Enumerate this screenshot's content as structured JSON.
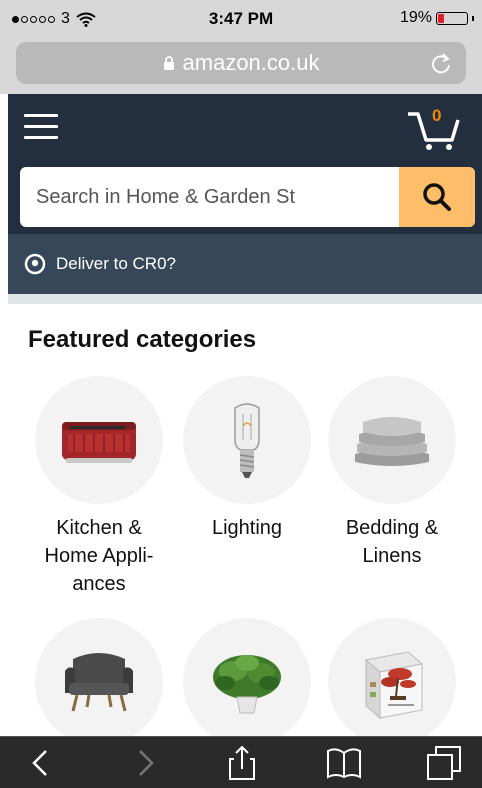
{
  "status_bar": {
    "carrier": "3",
    "time": "3:47 PM",
    "battery": "19%",
    "battery_level": 0.19,
    "signal_icon": "signal-dots-icon",
    "wifi_icon": "wifi-icon"
  },
  "browser": {
    "url": "amazon.co.uk",
    "lock_icon": "lock-icon",
    "reload_icon": "reload-icon"
  },
  "header": {
    "menu_icon": "hamburger-menu-icon",
    "cart_icon": "cart-icon",
    "cart_count": "0"
  },
  "search": {
    "placeholder": "Search in Home & Garden St",
    "search_icon": "search-icon"
  },
  "delivery": {
    "label": "Deliver to CR0?",
    "icon": "location-pin-icon"
  },
  "featured": {
    "title": "Featured categories",
    "categories": [
      {
        "label": "Kitchen & Home Appli-ances",
        "line1": "Kitchen &",
        "line2": "Home Appli-",
        "line3": "ances",
        "image": "toaster-image"
      },
      {
        "label": "Lighting",
        "line1": "Lighting",
        "image": "light-bulb-image"
      },
      {
        "label": "Bedding & Linens",
        "line1": "Bedding &",
        "line2": "Linens",
        "image": "pillows-image"
      },
      {
        "label": "",
        "image": "armchair-image"
      },
      {
        "label": "",
        "image": "plant-image"
      },
      {
        "label": "",
        "image": "bonsai-kit-image"
      }
    ]
  },
  "toolbar": {
    "back_icon": "back-chevron-icon",
    "forward_icon": "forward-chevron-icon",
    "share_icon": "share-icon",
    "bookmarks_icon": "bookmarks-icon",
    "tabs_icon": "tabs-icon"
  },
  "colors": {
    "header_bg": "#232f3e",
    "delivery_bg": "#37475a",
    "search_button": "#febd69",
    "cart_count": "#f08804",
    "battery_red": "#e0202b"
  }
}
